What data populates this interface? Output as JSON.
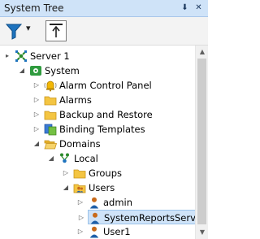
{
  "window": {
    "title": "System Tree",
    "pin_glyph": "⬇",
    "close_glyph": "✕"
  },
  "toolbar": {
    "filter_icon": "filter-icon",
    "dropdown_glyph": "▾",
    "navigate_up_icon": "navigate-up-icon"
  },
  "tree": [
    {
      "label": "Server 1",
      "icon": "server-icon",
      "expander": "▸",
      "level": 0
    },
    {
      "label": "System",
      "icon": "system-icon",
      "expander": "◢",
      "level": 1
    },
    {
      "label": "Alarm Control Panel",
      "icon": "bell-icon",
      "expander": "▷",
      "level": 2
    },
    {
      "label": "Alarms",
      "icon": "folder-icon",
      "expander": "▷",
      "level": 2
    },
    {
      "label": "Backup and Restore",
      "icon": "folder-icon",
      "expander": "▷",
      "level": 2
    },
    {
      "label": "Binding Templates",
      "icon": "binding-templates-icon",
      "expander": "▷",
      "level": 2
    },
    {
      "label": "Domains",
      "icon": "folder-open-icon",
      "expander": "◢",
      "level": 2
    },
    {
      "label": "Local",
      "icon": "domain-icon",
      "expander": "◢",
      "level": 3
    },
    {
      "label": "Groups",
      "icon": "folder-icon",
      "expander": "▷",
      "level": 4
    },
    {
      "label": "Users",
      "icon": "users-folder-icon",
      "expander": "◢",
      "level": 4
    },
    {
      "label": "admin",
      "icon": "user-icon",
      "expander": "▷",
      "level": 5
    },
    {
      "label": "SystemReportsService",
      "icon": "user-icon",
      "expander": "▷",
      "level": 5,
      "selected": true
    },
    {
      "label": "User1",
      "icon": "user-icon",
      "expander": "▷",
      "level": 5
    }
  ],
  "scrollbar": {
    "up_glyph": "▲",
    "down_glyph": "▼"
  }
}
